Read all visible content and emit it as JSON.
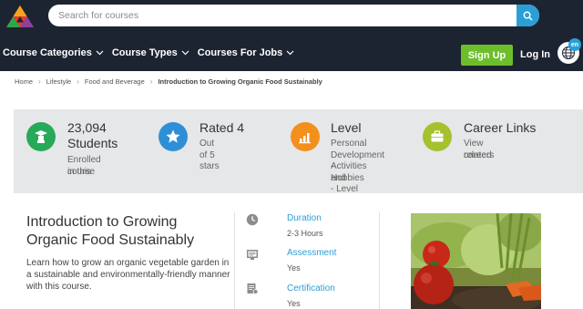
{
  "search": {
    "placeholder": "Search for courses"
  },
  "nav": {
    "items": [
      {
        "label": "Course Categories"
      },
      {
        "label": "Course Types"
      },
      {
        "label": "Courses For Jobs"
      }
    ],
    "signup_label": "Sign Up",
    "login_label": "Log In",
    "language": "en"
  },
  "breadcrumb": [
    "Home",
    "Lifestyle",
    "Food and Beverage",
    "Introduction to Growing Organic Food Sustainably"
  ],
  "stats": [
    {
      "icon": "graduate-icon",
      "color": "#27a95a",
      "title_lines": [
        "23,094",
        "Students"
      ],
      "sub_lines": [
        "Enrolled in this",
        "course"
      ]
    },
    {
      "icon": "star-icon",
      "color": "#2f8fd6",
      "title_lines": [
        "Rated 4"
      ],
      "sub_lines": [
        "Out of 5 stars"
      ]
    },
    {
      "icon": "bar-chart-icon",
      "color": "#f3901d",
      "title_lines": [
        "Level"
      ],
      "sub_lines": [
        "Personal",
        "Development -",
        "Activities and",
        "Hobbies - Level 1"
      ]
    },
    {
      "icon": "briefcase-icon",
      "color": "#a4c12e",
      "title_lines": [
        "Career Links"
      ],
      "sub_lines": [
        "View related",
        "careers"
      ]
    }
  ],
  "course": {
    "title": "Introduction to Growing Organic Food Sustainably",
    "description": "Learn how to grow an organic vegetable garden in a sustainable and environmentally-friendly manner with this course."
  },
  "meta": [
    {
      "icon": "clock-icon",
      "label": "Duration",
      "value": "2-3 Hours"
    },
    {
      "icon": "assessment-icon",
      "label": "Assessment",
      "value": "Yes"
    },
    {
      "icon": "certificate-icon",
      "label": "Certification",
      "value": "Yes"
    }
  ],
  "colors": {
    "header_bg": "#1d2431",
    "accent_blue": "#2a9fd6",
    "signup_green": "#6cbf2a",
    "stats_bg": "#e6e7e8"
  }
}
